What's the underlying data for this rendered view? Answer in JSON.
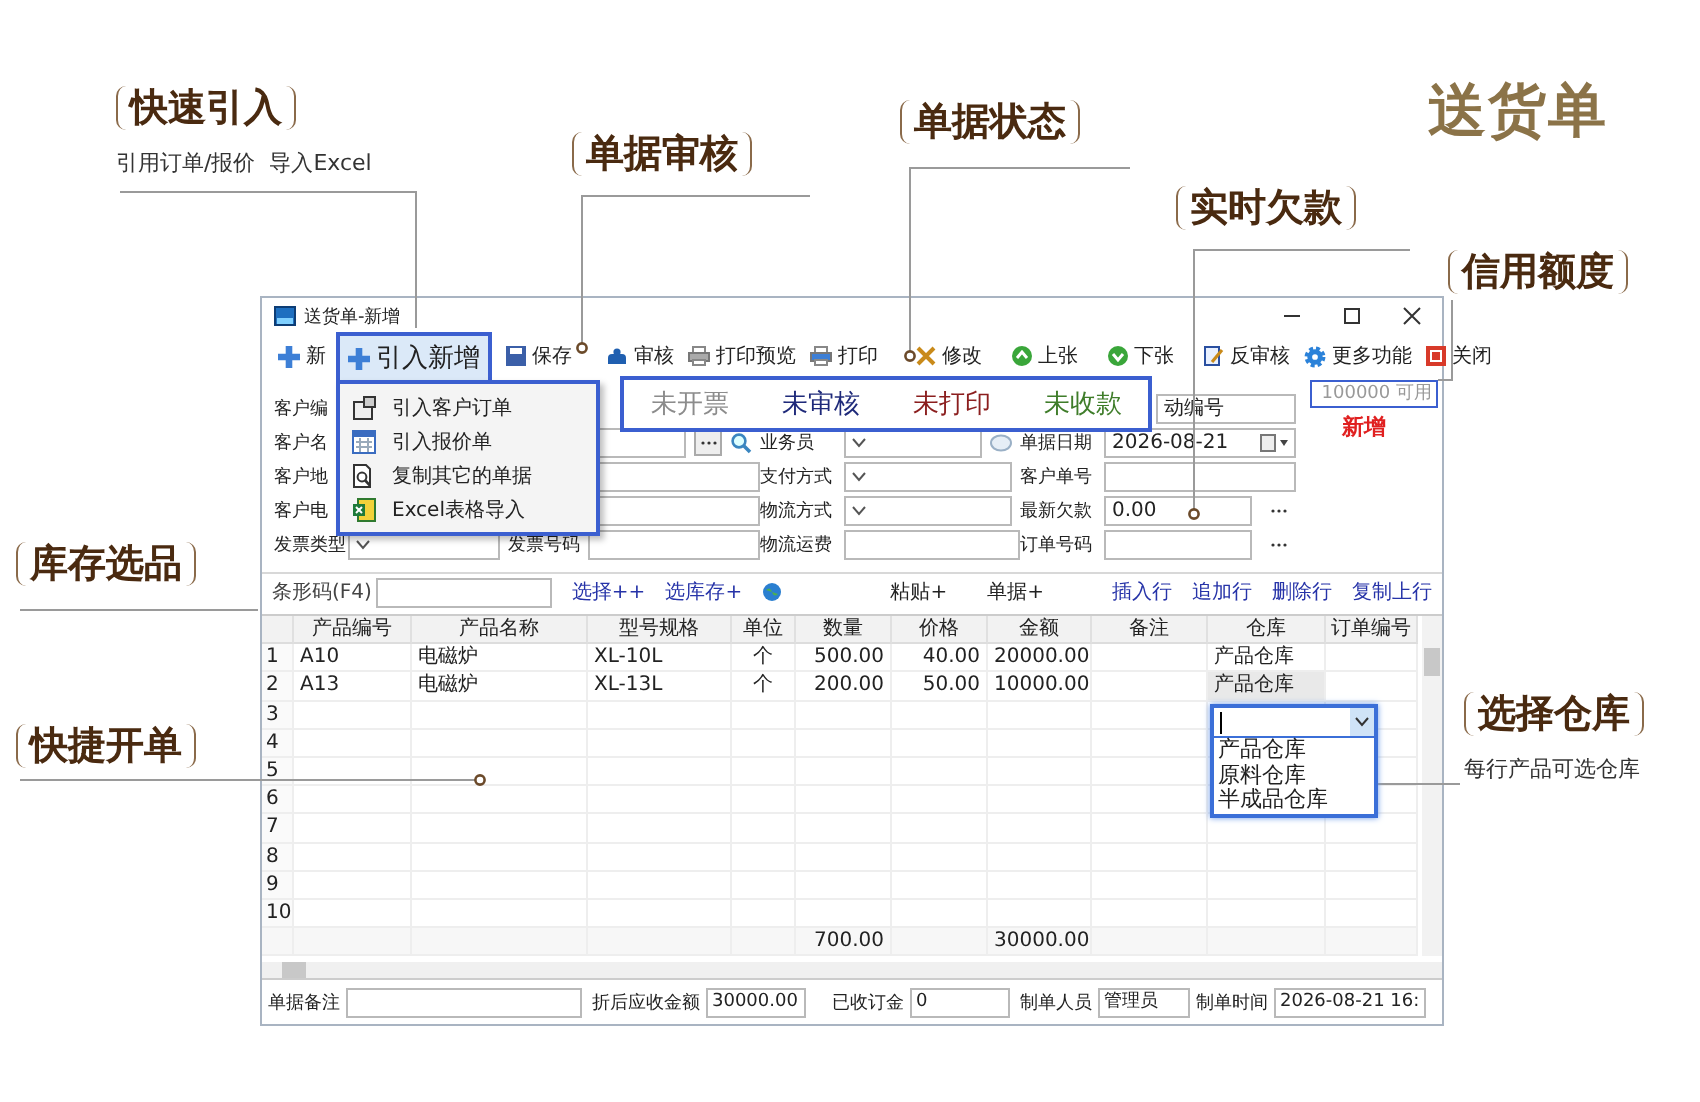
{
  "page_title": "送货单",
  "callouts": [
    {
      "title": "快速引入",
      "subtitle": "引用订单/报价  导入Excel"
    },
    {
      "title": "单据审核"
    },
    {
      "title": "单据状态"
    },
    {
      "title": "实时欠款"
    },
    {
      "title": "信用额度"
    },
    {
      "title": "库存选品"
    },
    {
      "title": "快捷开单"
    },
    {
      "title": "选择仓库",
      "subtitle": "每行产品可选仓库"
    }
  ],
  "window": {
    "title": "送货单-新增"
  },
  "toolbar": [
    {
      "label": "新",
      "kind": "plus"
    },
    {
      "label": "引入新增",
      "kind": "import",
      "expanded": true
    },
    {
      "label": "保存",
      "kind": "save"
    },
    {
      "label": "审核",
      "kind": "audit"
    },
    {
      "label": "打印预览",
      "kind": "preview"
    },
    {
      "label": "打印",
      "kind": "print"
    },
    {
      "label": "修改",
      "kind": "edit"
    },
    {
      "label": "上张",
      "kind": "prev"
    },
    {
      "label": "下张",
      "kind": "next"
    },
    {
      "label": "反审核",
      "kind": "unaudit"
    },
    {
      "label": "更多功能",
      "kind": "more"
    },
    {
      "label": "关闭",
      "kind": "close"
    }
  ],
  "import_menu": [
    {
      "label": "引入客户订单",
      "kind": "order"
    },
    {
      "label": "引入报价单",
      "kind": "quote"
    },
    {
      "label": "复制其它的单据",
      "kind": "copy"
    },
    {
      "label": "Excel表格导入",
      "kind": "excel"
    }
  ],
  "statuses": [
    {
      "label": "未开票",
      "color": "#8c8c8c"
    },
    {
      "label": "未审核",
      "color": "#1f2a7a"
    },
    {
      "label": "未打印",
      "color": "#8b1e1e"
    },
    {
      "label": "未收款",
      "color": "#3f7d2a"
    }
  ],
  "credit": {
    "value": "100000 可用",
    "note": "新增"
  },
  "form": [
    [
      {
        "kind": "label",
        "text": "客户编"
      },
      {
        "kind": "covered"
      },
      {
        "kind": "text",
        "value": "动编号"
      }
    ],
    [
      {
        "kind": "label",
        "text": "客户名"
      },
      {
        "kind": "lookup"
      },
      {
        "kind": "label",
        "text": "业务员"
      },
      {
        "kind": "combo_refresh"
      },
      {
        "kind": "label",
        "text": "单据日期"
      },
      {
        "kind": "date",
        "value": "2026-08-21"
      }
    ],
    [
      {
        "kind": "label",
        "text": "客户地"
      },
      {
        "kind": "wide"
      },
      {
        "kind": "label",
        "text": "支付方式"
      },
      {
        "kind": "combo"
      },
      {
        "kind": "label",
        "text": "客户单号"
      },
      {
        "kind": "text"
      }
    ],
    [
      {
        "kind": "label",
        "text": "客户电"
      },
      {
        "kind": "wide"
      },
      {
        "kind": "label",
        "text": "物流方式"
      },
      {
        "kind": "combo"
      },
      {
        "kind": "label",
        "text": "最新欠款"
      },
      {
        "kind": "more",
        "value": "0.00"
      }
    ],
    [
      {
        "kind": "label",
        "text": "发票类型"
      },
      {
        "kind": "combo"
      },
      {
        "kind": "label",
        "text": "发票号码"
      },
      {
        "kind": "text"
      },
      {
        "kind": "label",
        "text": "物流运费"
      },
      {
        "kind": "text"
      },
      {
        "kind": "label",
        "text": "订单号码"
      },
      {
        "kind": "more"
      }
    ]
  ],
  "barcode": {
    "label": "条形码(F4)",
    "links": [
      "选择++",
      "选库存+"
    ],
    "actions": [
      "粘贴+",
      "单据+"
    ],
    "row_actions": [
      "插入行",
      "追加行",
      "删除行",
      "复制上行"
    ]
  },
  "table": {
    "columns": [
      "产品编号",
      "产品名称",
      "型号规格",
      "单位",
      "数量",
      "价格",
      "金额",
      "备注",
      "仓库",
      "订单编号"
    ],
    "rows": [
      {
        "no": "1",
        "code": "A10",
        "name": "电磁炉",
        "spec": "XL-10L",
        "unit": "个",
        "qty": "500.00",
        "price": "40.00",
        "amount": "20000.00",
        "warehouse": "产品仓库",
        "focused": false
      },
      {
        "no": "2",
        "code": "A13",
        "name": "电磁炉",
        "spec": "XL-13L",
        "unit": "个",
        "qty": "200.00",
        "price": "50.00",
        "amount": "10000.00",
        "warehouse": "产品仓库",
        "focused": true
      },
      {
        "no": "3",
        "focused": false
      },
      {
        "no": "4",
        "focused": false
      },
      {
        "no": "5",
        "focused": false
      },
      {
        "no": "6",
        "focused": false
      },
      {
        "no": "7",
        "focused": false
      },
      {
        "no": "8",
        "focused": false
      },
      {
        "no": "9",
        "focused": false
      },
      {
        "no": "10",
        "focused": false
      }
    ],
    "totals": {
      "qty": "700.00",
      "amount": "30000.00"
    }
  },
  "warehouse_dropdown": {
    "options": [
      "产品仓库",
      "原料仓库",
      "半成品仓库"
    ]
  },
  "footer": [
    {
      "label": "单据备注"
    },
    {
      "label": "折后应收金额",
      "value": "30000.00"
    },
    {
      "label": "已收订金",
      "value": "0"
    },
    {
      "label": "制单人员",
      "value": "管理员"
    },
    {
      "label": "制单时间",
      "value": "2026-08-21 16:"
    }
  ]
}
